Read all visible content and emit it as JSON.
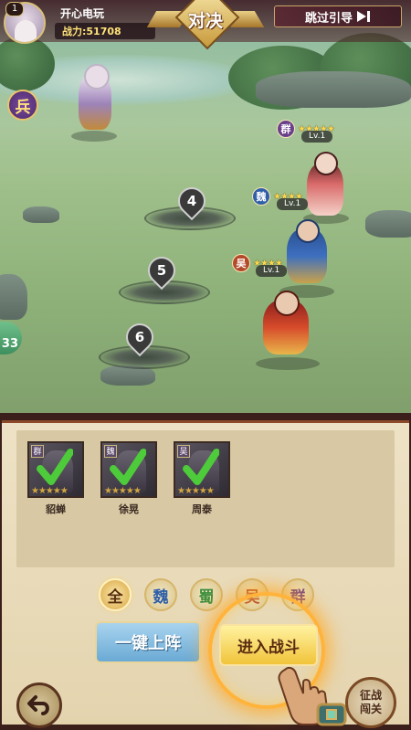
{
  "player": {
    "level": "1",
    "name": "开心电玩",
    "power": "战力:51708"
  },
  "header": {
    "title": "对决",
    "skip_label": "跳过引导"
  },
  "icons": {
    "skip": "skip-forward-icon",
    "back": "back-arrow-icon",
    "hand": "pointing-hand-icon"
  },
  "scene": {
    "side_badge": "兵",
    "side_tab_count": "33",
    "slots": [
      "4",
      "5",
      "6"
    ],
    "enemies": [
      {
        "faction": "群",
        "stars": "★★★★★",
        "level": "Lv.1"
      },
      {
        "faction": "魏",
        "stars": "★★★★",
        "level": "Lv.1"
      },
      {
        "faction": "吴",
        "stars": "★★★★",
        "level": "Lv.1"
      }
    ]
  },
  "roster": [
    {
      "faction": "群",
      "name": "貂蝉",
      "stars": "★★★★★"
    },
    {
      "faction": "魏",
      "name": "徐晃",
      "stars": "★★★★★"
    },
    {
      "faction": "吴",
      "name": "周泰",
      "stars": "★★★★★"
    }
  ],
  "filters": [
    "全",
    "魏",
    "蜀",
    "吴",
    "群"
  ],
  "actions": {
    "one_click": "一键上阵",
    "enter_battle": "进入战斗",
    "conquer_line1": "征战",
    "conquer_line2": "闯关"
  },
  "colors": {
    "wei": "#2f5fa8",
    "shu": "#3e8f3e",
    "wu": "#b34a2a",
    "qun": "#6a3f8a",
    "all": "#d9a640"
  }
}
